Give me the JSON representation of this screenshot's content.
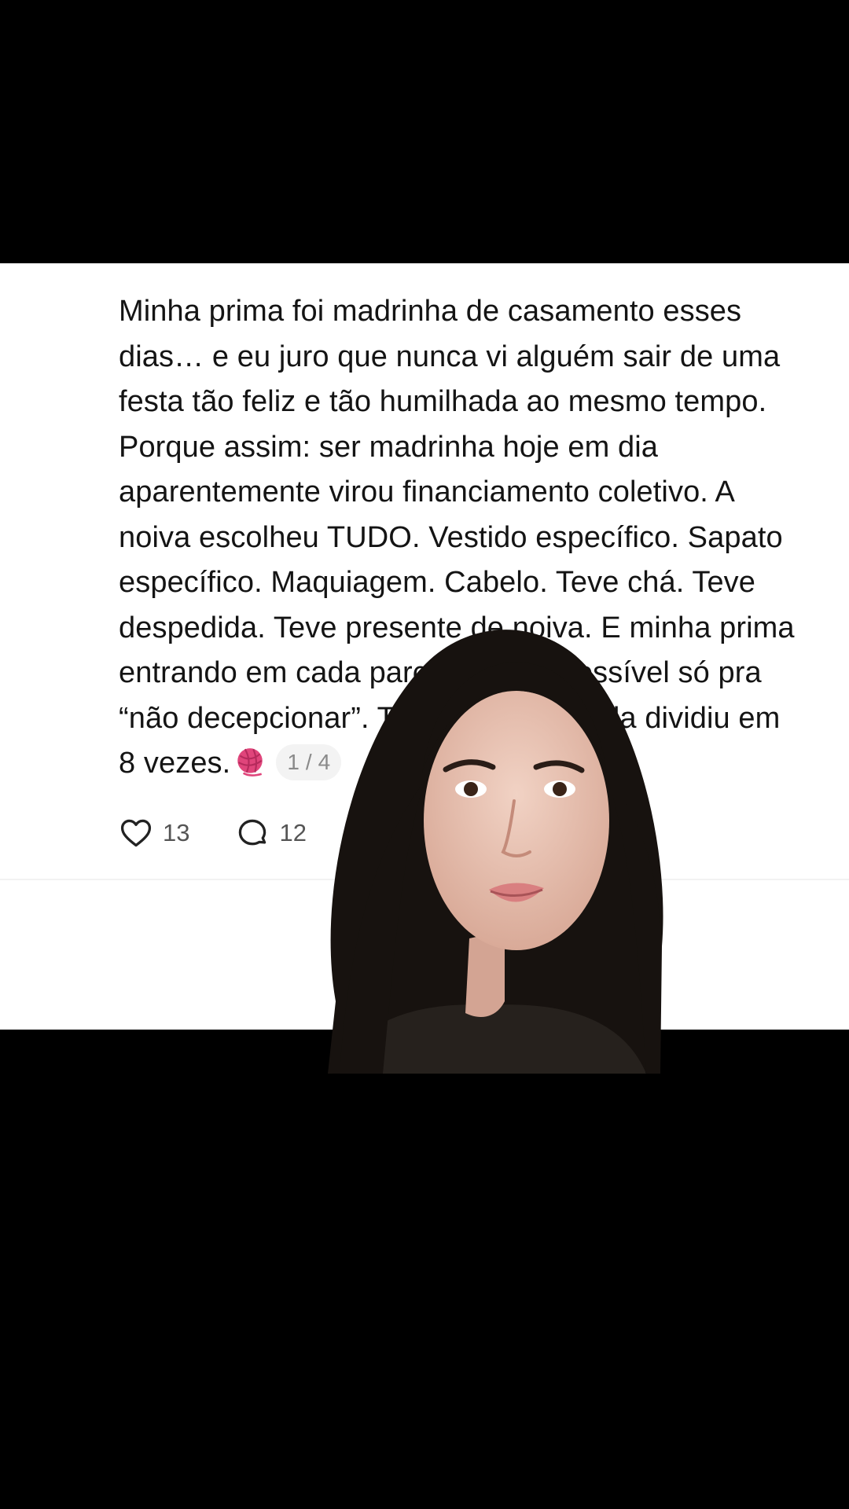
{
  "post": {
    "lines": [
      "Minha prima foi madrinha de casamento esses",
      "dias… e eu juro que nunca vi alguém sair de uma",
      "festa tão feliz e tão humilhada ao mesmo tempo.",
      "Porque assim: ser madrinha hoje em dia",
      "aparentemente virou financiamento coletivo. A",
      "noiva escolheu TUDO. Vestido específico. Sapato",
      "específico. Maquiagem. Cabelo. Teve chá. Teve",
      "despedida. Teve presente de noiva. E minha prima",
      "entrando em cada parcelamento possível só pra",
      "“não decepcionar”. Tinha coisa que ela dividiu em",
      "8 vezes."
    ],
    "emoji": "yarn-ball",
    "thread_counter": "1 / 4"
  },
  "actions": {
    "likes": {
      "icon": "heart-icon",
      "count": "13"
    },
    "comments": {
      "icon": "comment-icon",
      "count": "12"
    },
    "repost": {
      "icon": "repost-icon"
    }
  },
  "colors": {
    "background": "#000000",
    "card": "#ffffff",
    "text": "#141414",
    "muted": "#555555",
    "yarn": "#e0457b"
  }
}
